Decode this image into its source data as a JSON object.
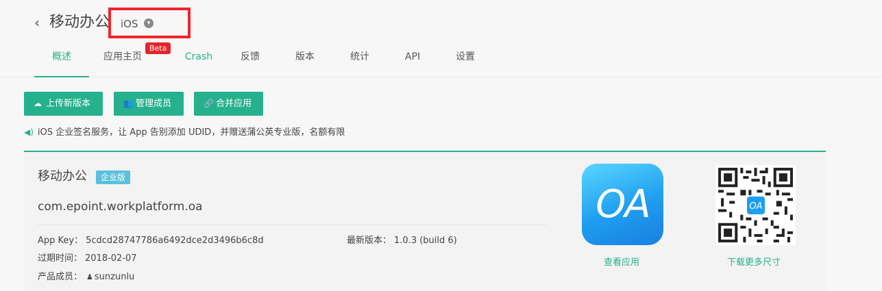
{
  "header": {
    "back_icon": "chevron-left-icon",
    "app_title": "移动办公",
    "platform": "iOS",
    "platform_icon": "chevron-down-circle-icon",
    "highlight_color": "#f2232b"
  },
  "tabs": [
    {
      "label": "概述",
      "active": true
    },
    {
      "label": "应用主页",
      "badge": "Beta"
    },
    {
      "label": "Crash",
      "highlight": true
    },
    {
      "label": "反馈"
    },
    {
      "label": "版本"
    },
    {
      "label": "统计"
    },
    {
      "label": "API"
    },
    {
      "label": "设置"
    }
  ],
  "actions": [
    {
      "label": "上传新版本",
      "icon": "cloud-upload-icon"
    },
    {
      "label": "管理成员",
      "icon": "users-icon"
    },
    {
      "label": "合并应用",
      "icon": "link-icon"
    }
  ],
  "notice": {
    "icon": "speaker-icon",
    "text": "iOS 企业签名服务，让 App 告别添加 UDID，并赠送蒲公英专业版，名额有限"
  },
  "app_card": {
    "name": "移动办公",
    "edition_badge": "企业版",
    "bundle_id": "com.epoint.workplatform.oa",
    "app_key_label": "App Key：",
    "app_key": "5cdcd28747786a6492dce2d3496b6c8d",
    "expire_label": "过期时间：",
    "expire_date": "2018-02-07",
    "members_label": "产品成员：",
    "member_name": "sunzunlu",
    "latest_version_label": "最新版本：",
    "latest_version": "1.0.3 (build 6)",
    "icon_text": "OA",
    "view_app_link": "查看应用",
    "download_more_link": "下载更多尺寸",
    "qr_logo_text": "OA"
  },
  "colors": {
    "accent": "#25b18c",
    "beta": "#e6242b",
    "enterprise": "#5bc0de"
  }
}
